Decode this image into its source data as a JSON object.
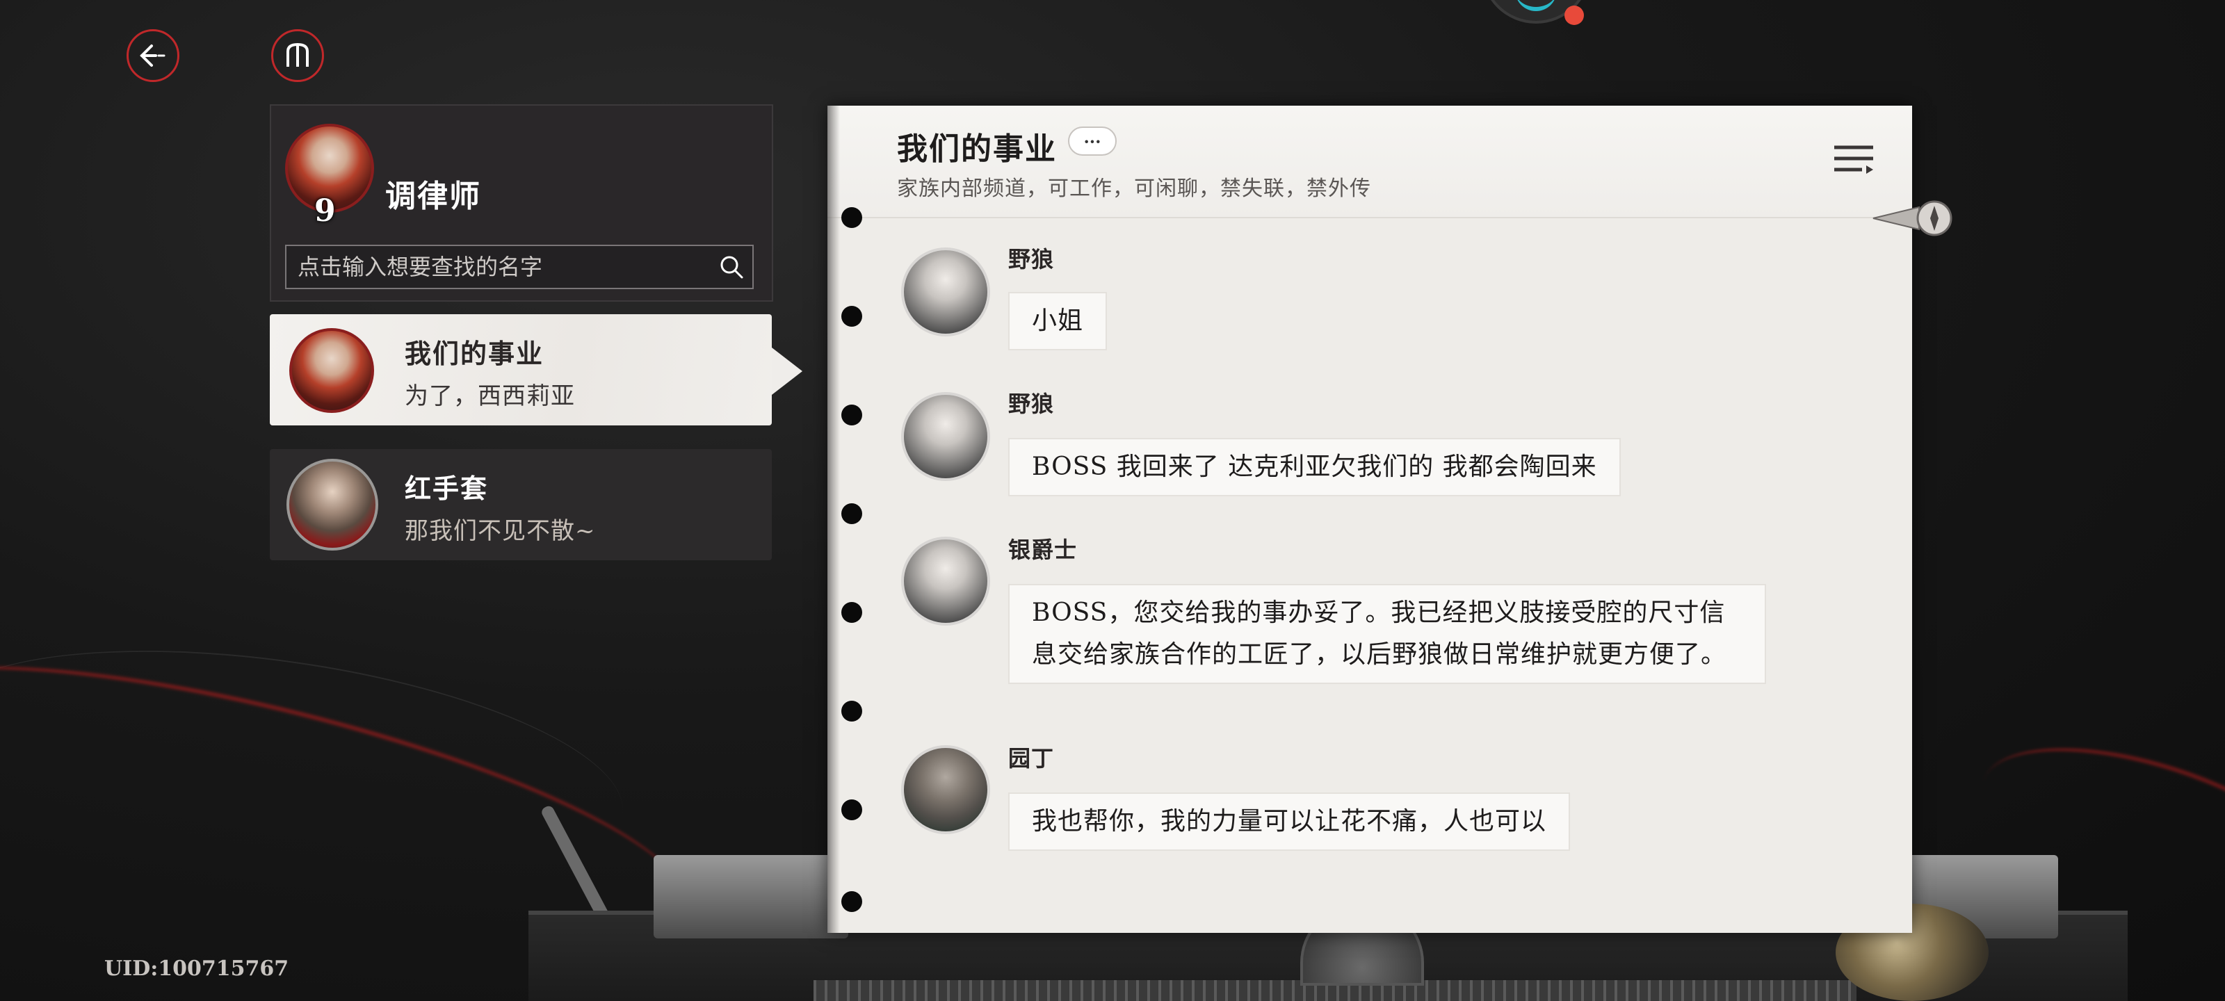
{
  "nav": {
    "back_icon": "back-arrow-icon",
    "menu_icon": "trident-icon"
  },
  "profile": {
    "level": "9",
    "name": "调律师",
    "search_placeholder": "点击输入想要查找的名字"
  },
  "chats": [
    {
      "title": "我们的事业",
      "preview": "为了，西西莉亚",
      "active": true
    },
    {
      "title": "红手套",
      "preview": "那我们不见不散~",
      "active": false
    }
  ],
  "conversation": {
    "title": "我们的事业",
    "more_label": "···",
    "description": "家族内部频道，可工作，可闲聊，禁失联，禁外传",
    "messages": [
      {
        "sender": "野狼",
        "text": "小姐"
      },
      {
        "sender": "野狼",
        "text": "BOSS 我回来了 达克利亚欠我们的 我都会陶回来"
      },
      {
        "sender": "银爵士",
        "text": "BOSS，您交给我的事办妥了。我已经把义肢接受腔的尺寸信息交给家族合作的工匠了，以后野狼做日常维护就更方便了。"
      },
      {
        "sender": "园丁",
        "text": "我也帮你，我的力量可以让花不痛，人也可以"
      }
    ]
  },
  "uid": "UID:100715767",
  "colors": {
    "accent_red": "#c0282a",
    "paper": "#eeece8",
    "panel_dark": "#2a2729"
  }
}
